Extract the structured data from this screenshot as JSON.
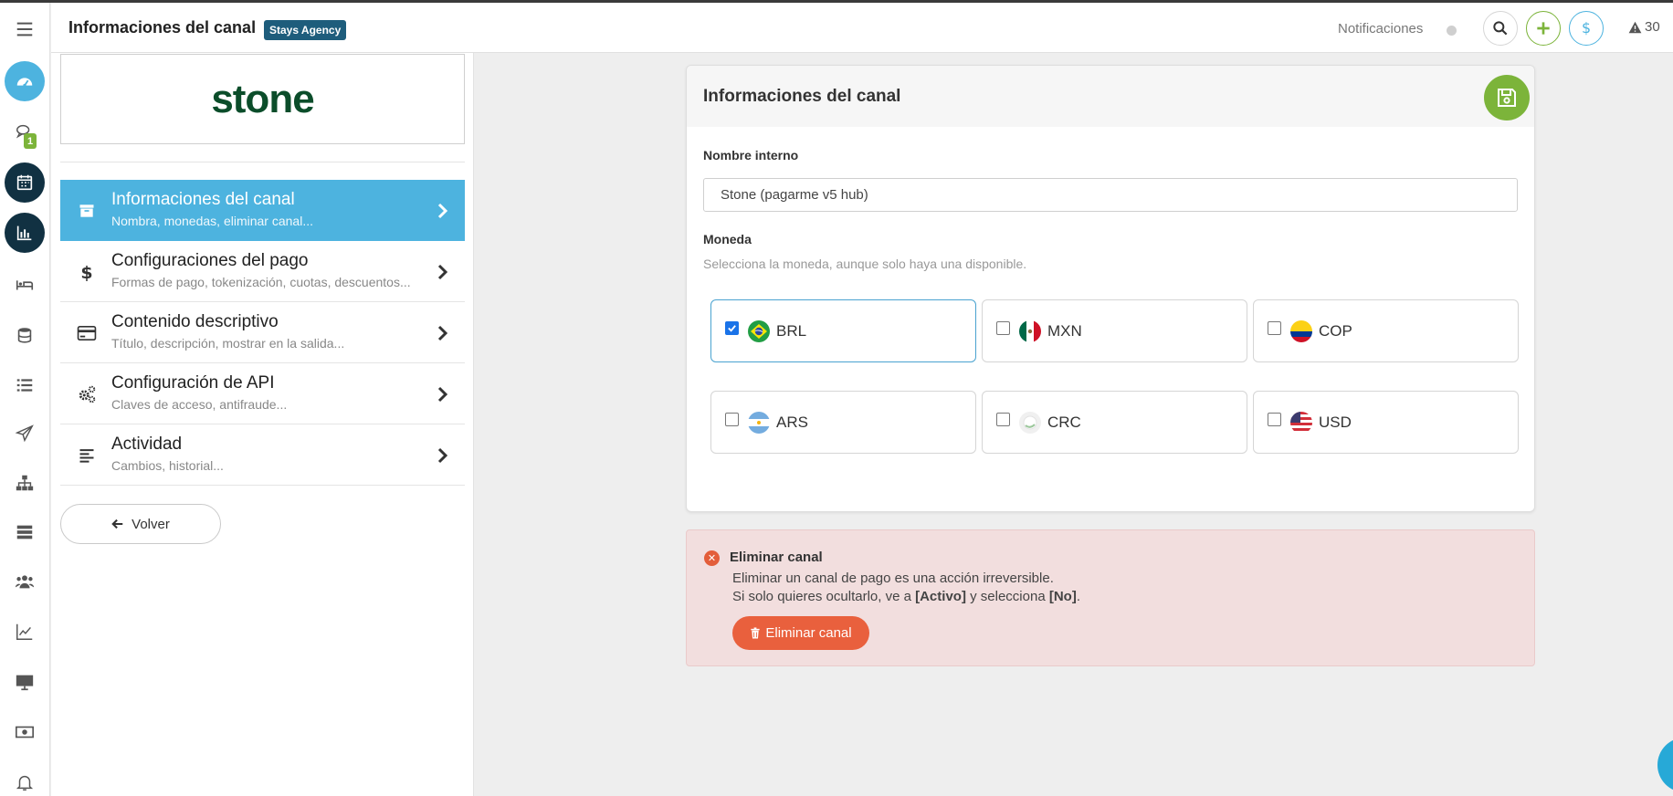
{
  "header": {
    "title": "Informaciones del canal",
    "agency_badge": "Stays Agency",
    "notifications_label": "Notificaciones",
    "alert_count": "30"
  },
  "rail": {
    "badge_count": "1",
    "icons": [
      "menu-icon",
      "dashboard-icon",
      "chat-icon",
      "calendar-icon",
      "bar-chart-icon",
      "bed-icon",
      "database-icon",
      "list-icon",
      "send-icon",
      "sitemap-icon",
      "server-icon",
      "users-icon",
      "line-chart-icon",
      "monitor-icon",
      "money-icon",
      "bell-icon"
    ]
  },
  "sidebar": {
    "logo_text": "stone",
    "items": [
      {
        "title": "Informaciones del canal",
        "subtitle": "Nombra, monedas, eliminar canal...",
        "icon": "archive-icon",
        "active": true
      },
      {
        "title": "Configuraciones del pago",
        "subtitle": "Formas de pago, tokenización, cuotas, descuentos...",
        "icon": "dollar-icon",
        "active": false
      },
      {
        "title": "Contenido descriptivo",
        "subtitle": "Título, descripción, mostrar en la salida...",
        "icon": "credit-card-icon",
        "active": false
      },
      {
        "title": "Configuración de API",
        "subtitle": "Claves de acceso, antifraude...",
        "icon": "cogs-icon",
        "active": false
      },
      {
        "title": "Actividad",
        "subtitle": "Cambios, historial...",
        "icon": "align-left-icon",
        "active": false
      }
    ],
    "back_label": "Volver"
  },
  "card": {
    "title": "Informaciones del canal",
    "internal_name_label": "Nombre interno",
    "internal_name_value": "Stone (pagarme v5 hub)",
    "currency_label": "Moneda",
    "currency_help": "Selecciona la moneda, aunque solo haya una disponible.",
    "currencies": [
      {
        "code": "BRL",
        "checked": true
      },
      {
        "code": "MXN",
        "checked": false
      },
      {
        "code": "COP",
        "checked": false
      },
      {
        "code": "ARS",
        "checked": false
      },
      {
        "code": "CRC",
        "checked": false
      },
      {
        "code": "USD",
        "checked": false
      }
    ]
  },
  "danger": {
    "title": "Eliminar canal",
    "line1": "Eliminar un canal de pago es una acción irreversible.",
    "line2_prefix": "Si solo quieres ocultarlo, ve a ",
    "line2_active": "[Activo]",
    "line2_mid": " y selecciona ",
    "line2_no": "[No]",
    "line2_suffix": ".",
    "button_label": "Eliminar canal"
  },
  "colors": {
    "accent_blue": "#4db3df",
    "rail_dark": "#113142",
    "green": "#7cb43a",
    "danger_bg": "#f2dede",
    "danger_button": "#e9603d",
    "agency_badge": "#1e5d7c"
  }
}
